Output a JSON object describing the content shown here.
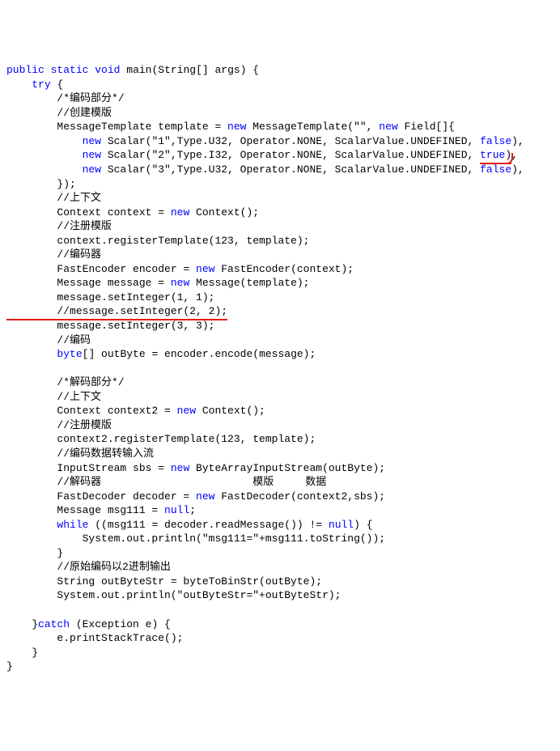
{
  "code": {
    "l0_a": "public",
    "l0_b": " ",
    "l0_c": "static",
    "l0_d": " ",
    "l0_e": "void",
    "l0_f": " main(String[] args) {",
    "l1_a": "    ",
    "l1_b": "try",
    "l1_c": " {",
    "l2": "        /*编码部分*/",
    "l3": "        //创建模版",
    "l4_a": "        MessageTemplate template = ",
    "l4_b": "new",
    "l4_c": " MessageTemplate(\"\", ",
    "l4_d": "new",
    "l4_e": " Field[]{",
    "l5_a": "            ",
    "l5_b": "new",
    "l5_c": " Scalar(\"1\",Type.U32, Operator.NONE, ScalarValue.UNDEFINED, ",
    "l5_d": "false",
    "l5_e": "),",
    "l6_a": "            ",
    "l6_b": "new",
    "l6_c": " Scalar(\"2\",Type.I32, Operator.NONE, ScalarValue.UNDEFINED, ",
    "l6_d": "true",
    "l6_e": ")",
    "l6_f": ",",
    "l7_a": "            ",
    "l7_b": "new",
    "l7_c": " Scalar(\"3\",Type.U32, Operator.NONE, ScalarValue.UNDEFINED, ",
    "l7_d": "false",
    "l7_e": "),",
    "l8": "        });",
    "l9": "        //上下文",
    "l10_a": "        Context context = ",
    "l10_b": "new",
    "l10_c": " Context();",
    "l11": "        //注册模版",
    "l12": "        context.registerTemplate(123, template);",
    "l13": "        //编码器",
    "l14_a": "        FastEncoder encoder = ",
    "l14_b": "new",
    "l14_c": " FastEncoder(context);",
    "l15_a": "        Message message = ",
    "l15_b": "new",
    "l15_c": " Message(template);",
    "l16": "        message.setInteger(1, 1);",
    "l17": "        //message.setInteger(2, 2);",
    "l18": "        message.setInteger(3, 3);",
    "l19": "        //编码",
    "l20_a": "        ",
    "l20_b": "byte",
    "l20_c": "[] outByte = encoder.encode(message);",
    "l21": "",
    "l22": "        /*解码部分*/",
    "l23": "        //上下文",
    "l24_a": "        Context context2 = ",
    "l24_b": "new",
    "l24_c": " Context();",
    "l25": "        //注册模版",
    "l26": "        context2.registerTemplate(123, template);",
    "l27": "        //编码数据转输入流",
    "l28_a": "        InputStream sbs = ",
    "l28_b": "new",
    "l28_c": " ByteArrayInputStream(outByte);",
    "l29": "        //解码器                        模版     数据",
    "l30_a": "        FastDecoder decoder = ",
    "l30_b": "new",
    "l30_c": " FastDecoder(context2,sbs);",
    "l31_a": "        Message msg111 = ",
    "l31_b": "null",
    "l31_c": ";",
    "l32_a": "        ",
    "l32_b": "while",
    "l32_c": " ((msg111 = decoder.readMessage()) != ",
    "l32_d": "null",
    "l32_e": ") {",
    "l33": "            System.out.println(\"msg111=\"+msg111.toString());",
    "l34": "        }",
    "l35": "        //原始编码以2进制输出",
    "l36": "        String outByteStr = byteToBinStr(outByte);",
    "l37": "        System.out.println(\"outByteStr=\"+outByteStr);",
    "l38": "",
    "l39_a": "    }",
    "l39_b": "catch",
    "l39_c": " (Exception e) {",
    "l40": "        e.printStackTrace();",
    "l41": "    }",
    "l42": "}"
  }
}
